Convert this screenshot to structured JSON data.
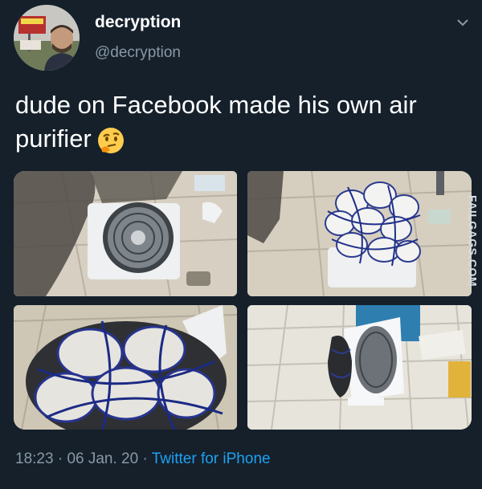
{
  "user": {
    "display_name": "decryption",
    "handle": "@decryption",
    "avatar_icon": "avatar-photo"
  },
  "tweet": {
    "text": "dude on Facebook made his own air purifier",
    "emoji": "thinking-face"
  },
  "media": {
    "photos": [
      {
        "name": "photo-fan-on-floor"
      },
      {
        "name": "photo-masks-net"
      },
      {
        "name": "photo-masks-closeup"
      },
      {
        "name": "photo-fan-side"
      }
    ],
    "watermark": "FAILGAGS.COM"
  },
  "meta": {
    "time": "18:23",
    "separator": " · ",
    "date": "06 Jan. 20",
    "source": "Twitter for iPhone"
  },
  "colors": {
    "background": "#15202b",
    "secondary_text": "#8899a6",
    "link": "#1da1f2"
  }
}
